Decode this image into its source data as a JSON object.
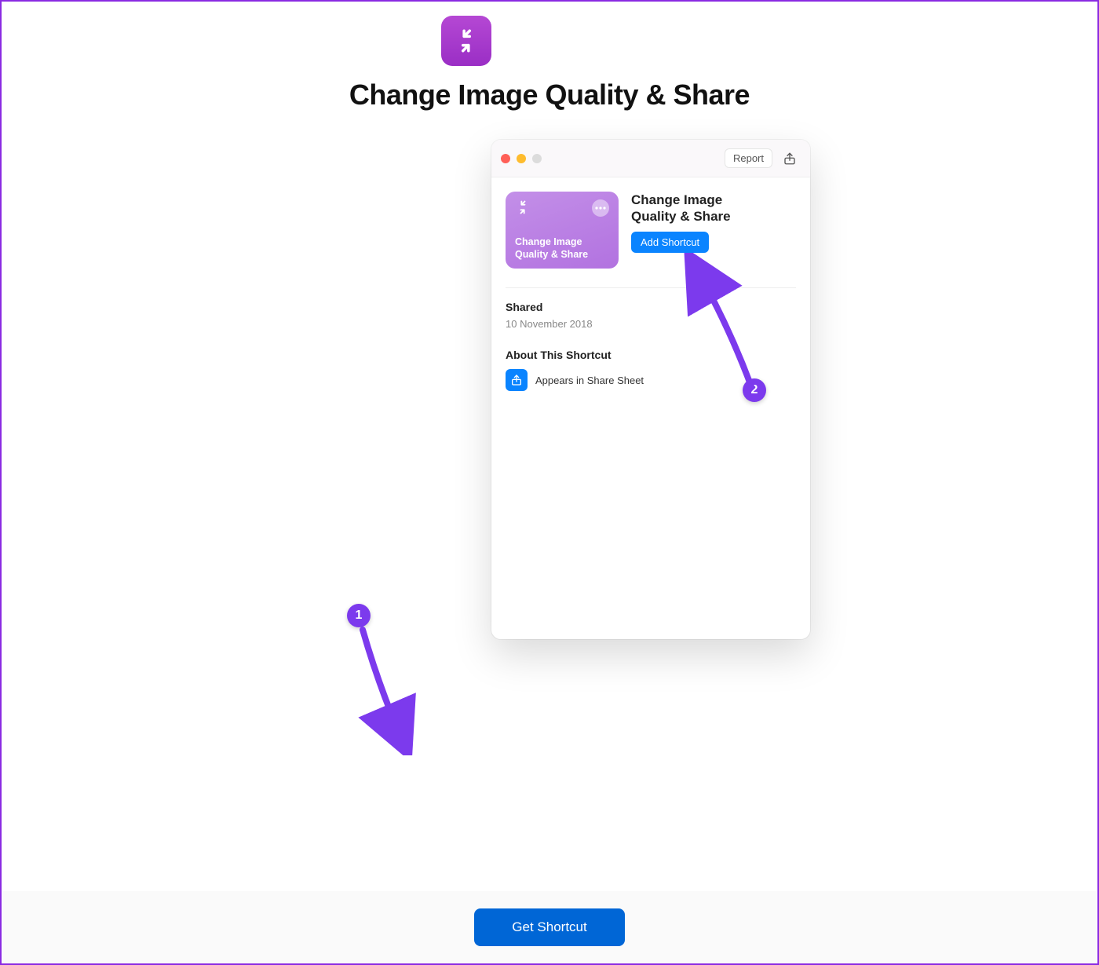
{
  "page": {
    "title": "Change Image Quality & Share",
    "icon_name": "compress-arrows-icon"
  },
  "window": {
    "report_label": "Report",
    "card": {
      "title_line1": "Change Image",
      "title_line2": "Quality & Share"
    },
    "detail": {
      "title_line1": "Change Image",
      "title_line2": "Quality & Share",
      "add_button": "Add Shortcut"
    },
    "shared": {
      "label": "Shared",
      "date": "10 November 2018"
    },
    "about": {
      "label": "About This Shortcut",
      "sheet_text": "Appears in Share Sheet"
    }
  },
  "bottom": {
    "get_button": "Get Shortcut"
  },
  "annotations": {
    "badge1": "1",
    "badge2": "2"
  }
}
